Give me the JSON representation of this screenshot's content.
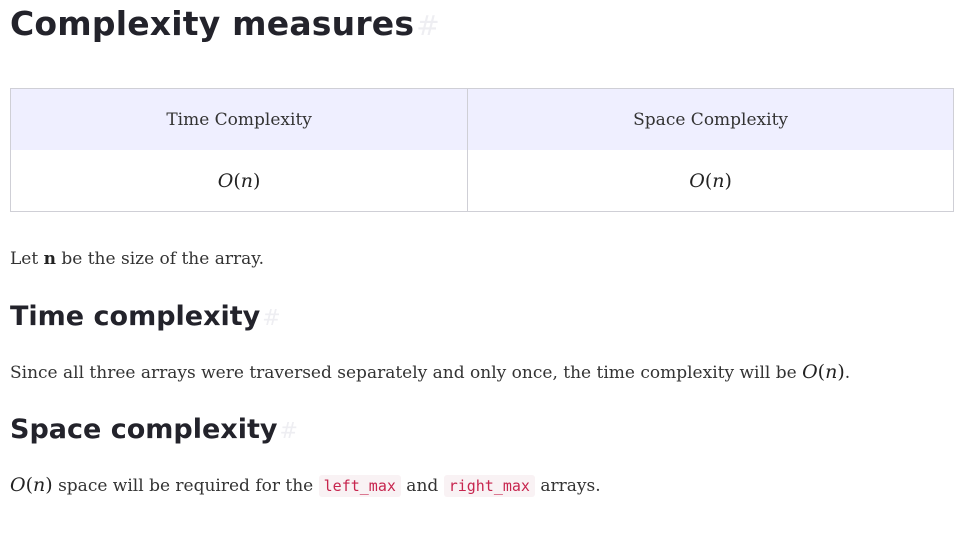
{
  "sections": {
    "main_heading": "Complexity measures",
    "anchor_symbol": "#",
    "table": {
      "headers": [
        "Time Complexity",
        "Space Complexity"
      ],
      "row": {
        "time": {
          "O": "O",
          "open": "(",
          "n": "n",
          "close": ")"
        },
        "space": {
          "O": "O",
          "open": "(",
          "n": "n",
          "close": ")"
        }
      }
    },
    "intro": {
      "before": "Let ",
      "bold": "n",
      "after": " be the size of the array."
    },
    "time": {
      "heading": "Time complexity",
      "text": "Since all three arrays were traversed separately and only once, the time complexity will be ",
      "math": {
        "O": "O",
        "open": "(",
        "n": "n",
        "close": ")"
      },
      "end": "."
    },
    "space": {
      "heading": "Space complexity",
      "math": {
        "O": "O",
        "open": "(",
        "n": "n",
        "close": ")"
      },
      "text1": " space will be required for the ",
      "code1": "left_max",
      "text2": " and ",
      "code2": "right_max",
      "text3": " arrays."
    }
  }
}
